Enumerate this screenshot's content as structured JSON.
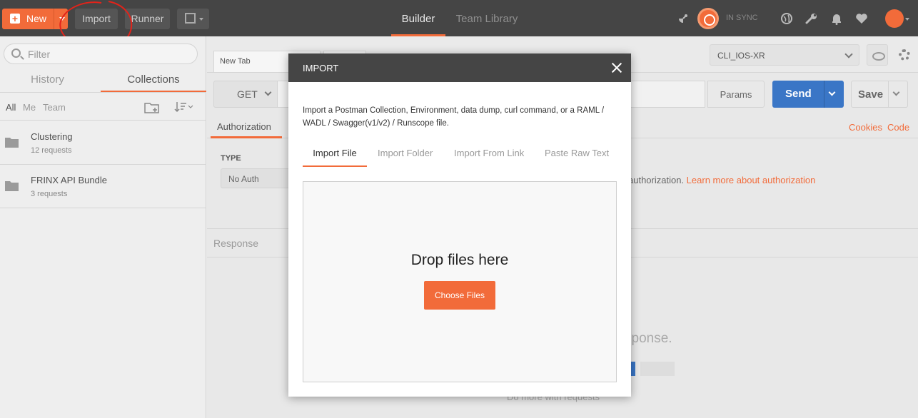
{
  "header": {
    "new_label": "New",
    "import_label": "Import",
    "runner_label": "Runner",
    "nav": {
      "builder": "Builder",
      "team_library": "Team Library"
    },
    "sync_status": "IN SYNC"
  },
  "sidebar": {
    "search_placeholder": "Filter",
    "tabs": {
      "history": "History",
      "collections": "Collections"
    },
    "filters": {
      "all": "All",
      "me": "Me",
      "team": "Team"
    },
    "collections": [
      {
        "name": "Clustering",
        "count": "12 requests"
      },
      {
        "name": "FRINX API Bundle",
        "count": "3 requests"
      }
    ]
  },
  "main": {
    "tab_title": "New Tab",
    "environment": "CLI_IOS-XR",
    "method": "GET",
    "params_label": "Params",
    "send_label": "Send",
    "save_label": "Save",
    "subtab_authorization": "Authorization",
    "cookies_link": "Cookies",
    "code_link": "Code",
    "type_label": "TYPE",
    "auth_type": "No Auth",
    "auth_text": "authorization. ",
    "auth_link": "Learn more about authorization",
    "response_label": "Response",
    "response_hint": "sponse.",
    "response_more": "Do more with requests"
  },
  "modal": {
    "title": "IMPORT",
    "description": "Import a Postman Collection, Environment, data dump, curl command, or a RAML / WADL / Swagger(v1/v2) / Runscope file.",
    "tabs": {
      "file": "Import File",
      "folder": "Import Folder",
      "link": "Import From Link",
      "raw": "Paste Raw Text"
    },
    "drop_text": "Drop files here",
    "choose_label": "Choose Files"
  },
  "colors": {
    "accent": "#f26b3a",
    "header_bg": "#454545",
    "send_blue": "#3a76c6",
    "annotation_red": "#e2231a"
  }
}
